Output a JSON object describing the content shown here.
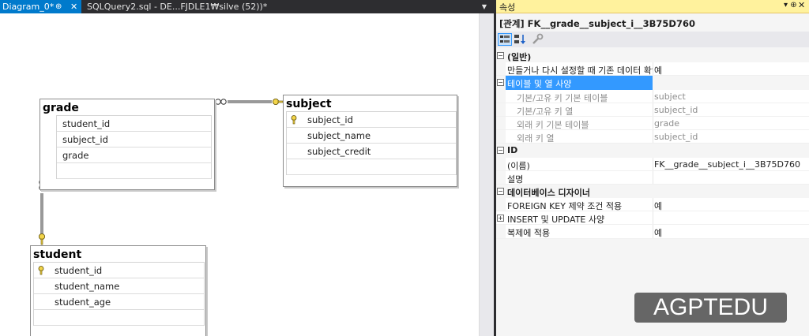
{
  "tabs": {
    "diagram": {
      "label": "Diagram_0*",
      "pin": "⊕",
      "close": "✕"
    },
    "sql": {
      "label": "SQLQuery2.sql - DE...FJDLE1₩silve (52))*"
    },
    "overflow": "▼"
  },
  "diagram": {
    "tables": {
      "grade": {
        "title": "grade",
        "columns": [
          "student_id",
          "subject_id",
          "grade"
        ]
      },
      "subject": {
        "title": "subject",
        "columns": [
          "subject_id",
          "subject_name",
          "subject_credit"
        ],
        "primary_key": "subject_id"
      },
      "student": {
        "title": "student",
        "columns": [
          "student_id",
          "student_name",
          "student_age"
        ],
        "primary_key": "student_id"
      }
    },
    "relationships": [
      {
        "from": "grade",
        "to": "subject",
        "many_side": "grade",
        "one_side": "subject"
      },
      {
        "from": "grade",
        "to": "student",
        "many_side": "grade",
        "one_side": "student"
      }
    ],
    "colors": {
      "key": "#e8c840",
      "line": "#333333"
    }
  },
  "properties": {
    "title": "속성",
    "pin": "▾ ⊕",
    "object_name": "[관계] FK__grade__subject_i__3B75D760",
    "groups": [
      {
        "name": "(일반)",
        "expanded": true,
        "rows": [
          {
            "name": "만들거나 다시 설정할 때 기존 데이터 확인",
            "value": "예"
          }
        ]
      },
      {
        "name": "테이블 및 열 사양",
        "expanded": true,
        "selected": true,
        "rows": [
          {
            "name": "기본/고유 키 기본 테이블",
            "value": "subject"
          },
          {
            "name": "기본/고유 키 열",
            "value": "subject_id"
          },
          {
            "name": "외래 키 기본 테이블",
            "value": "grade"
          },
          {
            "name": "외래 키 열",
            "value": "subject_id"
          }
        ]
      },
      {
        "name": "ID",
        "expanded": true,
        "rows": [
          {
            "name": "(이름)",
            "value": "FK__grade__subject_i__3B75D760"
          },
          {
            "name": "설명",
            "value": ""
          }
        ]
      },
      {
        "name": "데이터베이스 디자이너",
        "expanded": true,
        "rows": [
          {
            "name": "FOREIGN KEY 제약 조건 적용",
            "value": "예"
          },
          {
            "name": "INSERT 및 UPDATE 사양",
            "value": "",
            "collapsed_group": true
          },
          {
            "name": "복제에 적용",
            "value": "예"
          }
        ]
      }
    ],
    "colors": {
      "header": "#fff29d",
      "selection": "#3399ff"
    }
  },
  "watermark": "AGPTEDU"
}
